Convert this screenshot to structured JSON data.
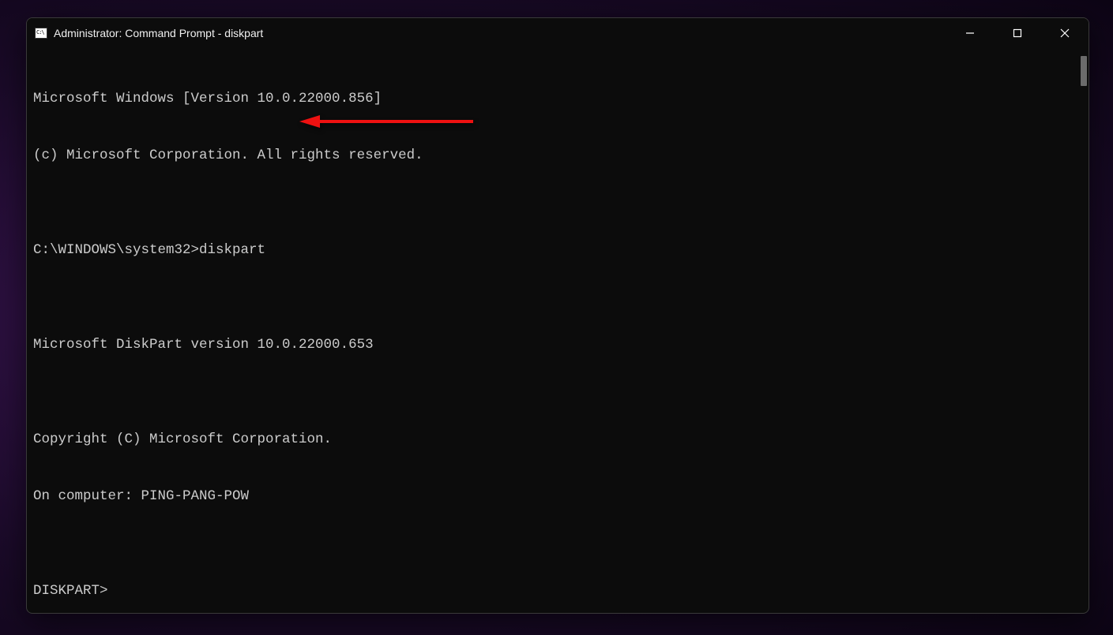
{
  "window": {
    "title": "Administrator: Command Prompt - diskpart"
  },
  "terminal": {
    "lines": [
      "Microsoft Windows [Version 10.0.22000.856]",
      "(c) Microsoft Corporation. All rights reserved.",
      "",
      "C:\\WINDOWS\\system32>diskpart",
      "",
      "Microsoft DiskPart version 10.0.22000.653",
      "",
      "Copyright (C) Microsoft Corporation.",
      "On computer: PING-PANG-POW",
      "",
      "DISKPART>"
    ]
  },
  "annotation": {
    "arrow_color": "#e11"
  }
}
